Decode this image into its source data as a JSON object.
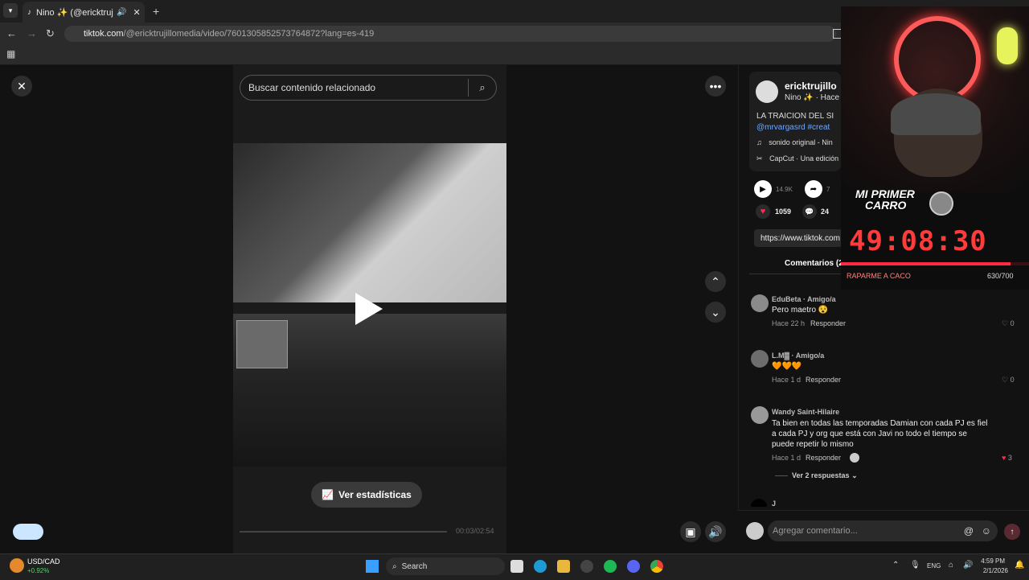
{
  "browser": {
    "tab_title": "Nino ✨ (@ericktrujillome",
    "tab_sound_icon": "speaker-icon",
    "url_domain": "tiktok.com",
    "url_path": "/@ericktrujillomedia/video/7601305852573764872?lang=es-419"
  },
  "page": {
    "search_placeholder": "Buscar contenido relacionado",
    "stats_button": "Ver estadísticas",
    "video_time": "00:03/02:54",
    "icons": {
      "close": "close-icon",
      "more": "more-icon",
      "up": "chevron-up-icon",
      "down": "chevron-down-icon",
      "volume": "volume-icon"
    }
  },
  "post": {
    "author": "ericktrujillo",
    "subtitle": "Nino ✨ · Hace",
    "caption": "LA TRAICION DEL SI",
    "hashtags": "@mrvargasrd #creat",
    "sound": "sonido original - Nin",
    "capcut": "CapCut · Una edición",
    "plays": "14.9K",
    "shares": "7",
    "likes": "1059",
    "comments_count": "24",
    "link": "https://www.tiktok.com",
    "comments_tab": "Comentarios (2"
  },
  "comments": [
    {
      "name": "EduBeta · Amigo/a",
      "text": "Pero maetro 😵",
      "time": "Hace 22 h",
      "reply": "Responder",
      "likes": "0"
    },
    {
      "name": "L.M▓ · Amigo/a",
      "text": "🧡🧡🧡",
      "time": "Hace 1 d",
      "reply": "Responder",
      "likes": "0"
    },
    {
      "name": "Wandy Saint-Hilaire",
      "text": "Ta bien en todas las temporadas Damian con cada PJ es fiel a cada PJ y org que está con Javi no todo el tiempo se puede repetir lo mismo",
      "time": "Hace 1 d",
      "reply": "Responder",
      "likes": "3"
    },
    {
      "name": "J",
      "text": "",
      "time": "",
      "reply": "",
      "likes": ""
    }
  ],
  "view_replies": "Ver 2 respuestas",
  "comment_input_placeholder": "Agregar comentario...",
  "overlay": {
    "title_line1": "MI PRIMER",
    "title_line2": "CARRO",
    "timer": "49:08:30",
    "goal_label": "RAPARME A CACO",
    "goal_progress": "630/700",
    "goal_fraction": 0.9
  },
  "taskbar": {
    "ticker": "USD/CAD",
    "ticker_change": "+0.92%",
    "search": "Search",
    "lang": "ENG",
    "time": "4:59 PM",
    "date": "2/1/2026"
  },
  "colors": {
    "accent_red": "#fe2c55",
    "hashtag_blue": "#6fa8ff",
    "timer_red": "#ff3b3b"
  }
}
